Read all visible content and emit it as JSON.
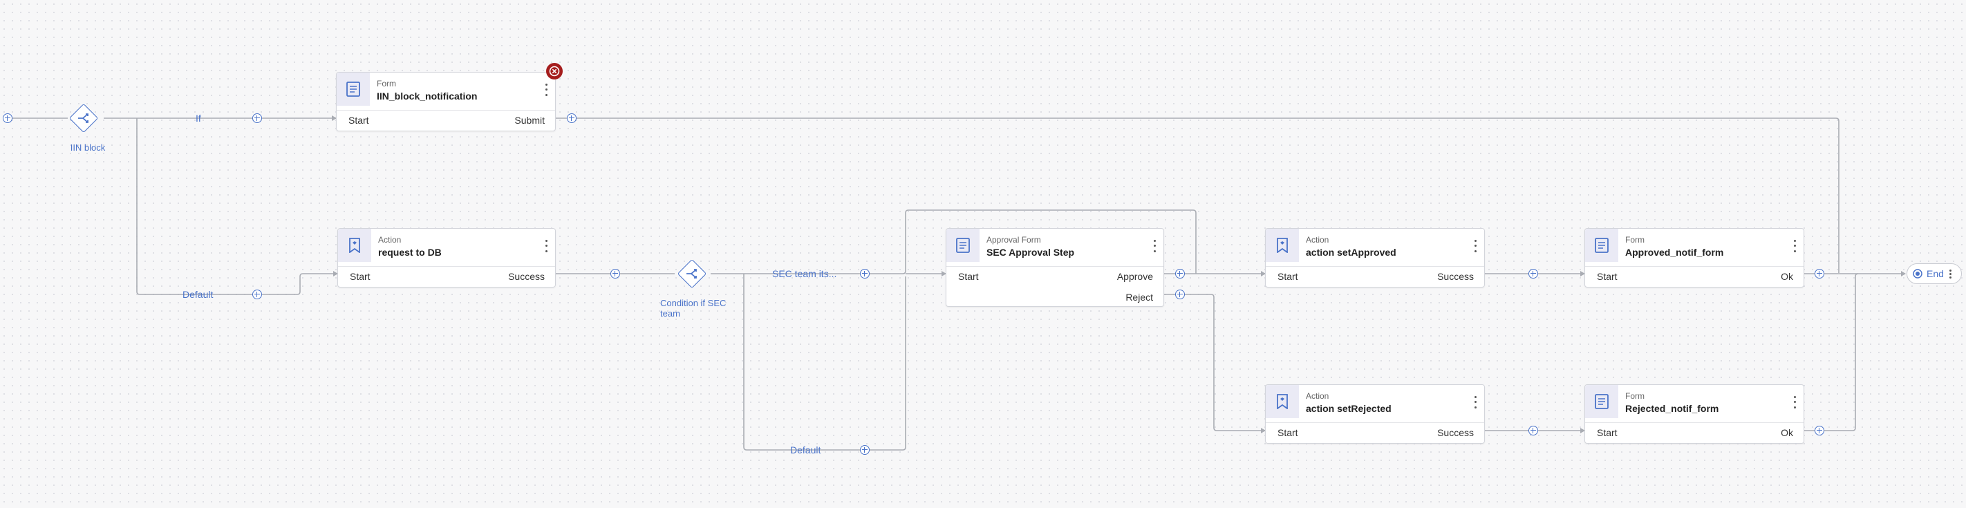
{
  "start_node": {
    "plus": "add-step"
  },
  "iin_block": {
    "label": "IIN block",
    "branch_if": "If",
    "branch_default": "Default"
  },
  "iin_form": {
    "type": "Form",
    "name": "IIN_block_notification",
    "port_in": "Start",
    "port_out": "Submit",
    "has_error": true
  },
  "request_action": {
    "type": "Action",
    "name": "request to DB",
    "port_in": "Start",
    "port_out": "Success"
  },
  "sec_condition": {
    "label": "Condition if SEC team",
    "branch_if": "SEC team its...",
    "branch_default": "Default"
  },
  "sec_approval": {
    "type": "Approval Form",
    "name": "SEC Approval Step",
    "port_in": "Start",
    "port_approve": "Approve",
    "port_reject": "Reject"
  },
  "set_approved": {
    "type": "Action",
    "name": "action setApproved",
    "port_in": "Start",
    "port_out": "Success"
  },
  "approved_form": {
    "type": "Form",
    "name": "Approved_notif_form",
    "port_in": "Start",
    "port_out": "Ok"
  },
  "set_rejected": {
    "type": "Action",
    "name": "action setRejected",
    "port_in": "Start",
    "port_out": "Success"
  },
  "rejected_form": {
    "type": "Form",
    "name": "Rejected_notif_form",
    "port_in": "Start",
    "port_out": "Ok"
  },
  "end_node": {
    "label": "End"
  },
  "colors": {
    "accent": "#4a73c9",
    "wire": "#a9acb3",
    "error": "#a51d1d",
    "icon_bg": "#eaeaf5"
  }
}
